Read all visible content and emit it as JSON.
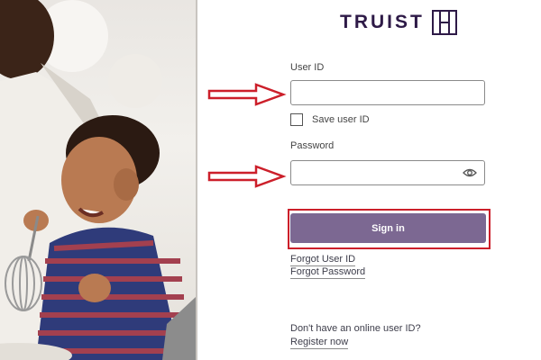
{
  "brand": {
    "name": "TRUIST"
  },
  "form": {
    "user_id_label": "User ID",
    "user_id_value": "",
    "save_user_id_label": "Save user ID",
    "save_user_id_checked": false,
    "password_label": "Password",
    "password_value": "",
    "sign_in_label": "Sign in",
    "forgot_user_id": "Forgot User ID",
    "forgot_password": "Forgot Password",
    "no_online_id_text": "Don't have an online user ID?",
    "register_now": "Register now"
  },
  "colors": {
    "brand": "#2e1a47",
    "button": "#7c6892",
    "annotation_red": "#cc1f2a"
  }
}
